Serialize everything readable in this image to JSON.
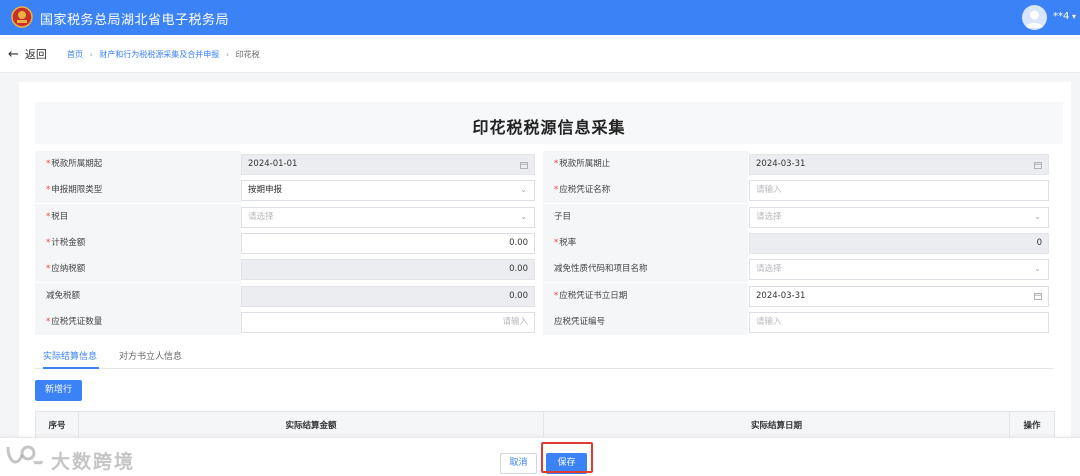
{
  "header": {
    "title": "国家税务总局湖北省电子税务局",
    "user_name": "**4",
    "user_caret": "▾"
  },
  "nav": {
    "back_label": "返回",
    "back_arrow": "←",
    "breadcrumb": [
      "首页",
      "财产和行为税税源采集及合并申报",
      "印花税"
    ],
    "separator": "›"
  },
  "form": {
    "title": "印花税税源信息采集",
    "rows": [
      {
        "left": {
          "label": "税款所属期起",
          "required": true,
          "value": "2024-01-01",
          "placeholder": "",
          "type": "date",
          "disabled": true,
          "align": "left"
        },
        "right": {
          "label": "税款所属期止",
          "required": true,
          "value": "2024-03-31",
          "placeholder": "",
          "type": "date",
          "disabled": true,
          "align": "left"
        }
      },
      {
        "left": {
          "label": "申报期限类型",
          "required": true,
          "value": "按期申报",
          "placeholder": "",
          "type": "select",
          "disabled": false,
          "align": "left"
        },
        "right": {
          "label": "应税凭证名称",
          "required": true,
          "value": "",
          "placeholder": "请输入",
          "type": "text",
          "disabled": false,
          "align": "left"
        }
      },
      {
        "left": {
          "label": "税目",
          "required": true,
          "value": "",
          "placeholder": "请选择",
          "type": "select",
          "disabled": false,
          "align": "left"
        },
        "right": {
          "label": "子目",
          "required": false,
          "value": "",
          "placeholder": "请选择",
          "type": "select",
          "disabled": false,
          "align": "left"
        }
      },
      {
        "left": {
          "label": "计税金额",
          "required": true,
          "value": "0.00",
          "placeholder": "",
          "type": "number",
          "disabled": false,
          "align": "right"
        },
        "right": {
          "label": "税率",
          "required": true,
          "value": "0",
          "placeholder": "",
          "type": "number",
          "disabled": true,
          "align": "right"
        }
      },
      {
        "left": {
          "label": "应纳税额",
          "required": true,
          "value": "0.00",
          "placeholder": "",
          "type": "number",
          "disabled": true,
          "align": "right"
        },
        "right": {
          "label": "减免性质代码和项目名称",
          "required": false,
          "value": "",
          "placeholder": "请选择",
          "type": "select",
          "disabled": false,
          "align": "left"
        }
      },
      {
        "left": {
          "label": "减免税额",
          "required": false,
          "value": "0.00",
          "placeholder": "",
          "type": "number",
          "disabled": true,
          "align": "right"
        },
        "right": {
          "label": "应税凭证书立日期",
          "required": true,
          "value": "2024-03-31",
          "placeholder": "",
          "type": "date",
          "disabled": false,
          "align": "left"
        }
      },
      {
        "left": {
          "label": "应税凭证数量",
          "required": true,
          "value": "",
          "placeholder": "请输入",
          "type": "text",
          "disabled": false,
          "align": "right"
        },
        "right": {
          "label": "应税凭证编号",
          "required": false,
          "value": "",
          "placeholder": "请输入",
          "type": "text",
          "disabled": false,
          "align": "left"
        }
      }
    ]
  },
  "tabs": [
    {
      "label": "实际结算信息",
      "active": true
    },
    {
      "label": "对方书立人信息",
      "active": false
    }
  ],
  "add_row_label": "新增行",
  "table": {
    "columns": [
      "序号",
      "实际结算金额",
      "实际结算日期",
      "操作"
    ]
  },
  "footer": {
    "cancel_label": "取消",
    "save_label": "保存"
  },
  "watermark": {
    "text": "大数跨境"
  },
  "icons": {
    "calendar": "calendar-icon",
    "dropdown": "chevron-down-icon"
  },
  "colors": {
    "primary": "#3a82f6",
    "required": "#f0423a",
    "highlight": "#e03a32"
  }
}
